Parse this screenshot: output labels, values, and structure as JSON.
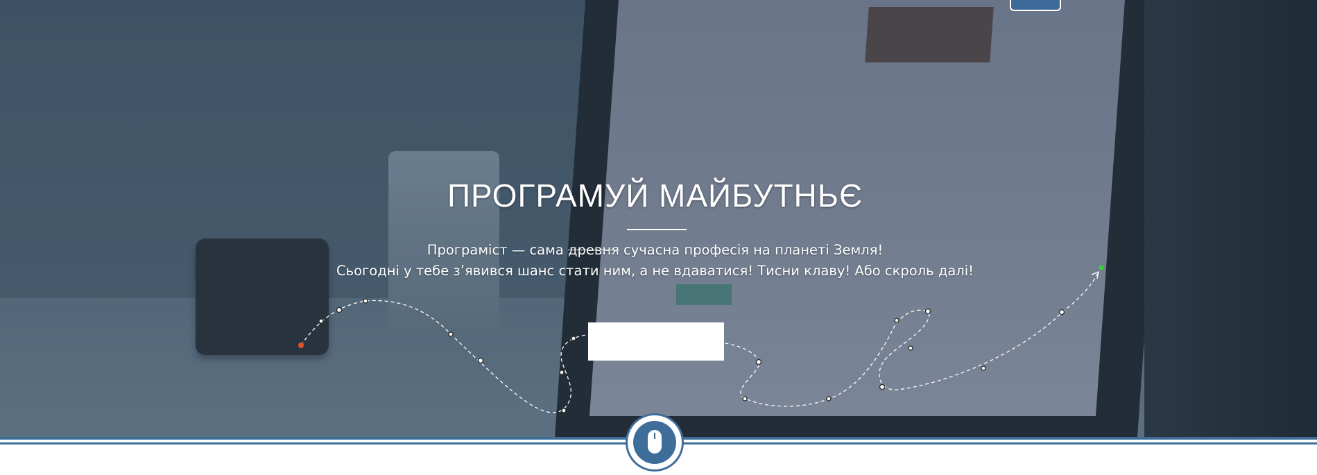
{
  "hero": {
    "title": "ПРОГРАМУЙ  МАЙБУТНЬЄ",
    "subtitle_line1_pre": "Програміст — сама ",
    "subtitle_line1_strike": "древня",
    "subtitle_line1_post": " сучасна  професія на планеті Земля!",
    "subtitle_line2": "Сьогодні  у тебе з’явився шанс стати ним, а не вдаватися! Тисни клаву! Або скроль далі!"
  },
  "colors": {
    "accent": "#3f6d9a",
    "path_start_dot": "#e0542a",
    "path_end_dot": "#3ecb3e"
  },
  "icons": {
    "scroll": "mouse-icon"
  }
}
